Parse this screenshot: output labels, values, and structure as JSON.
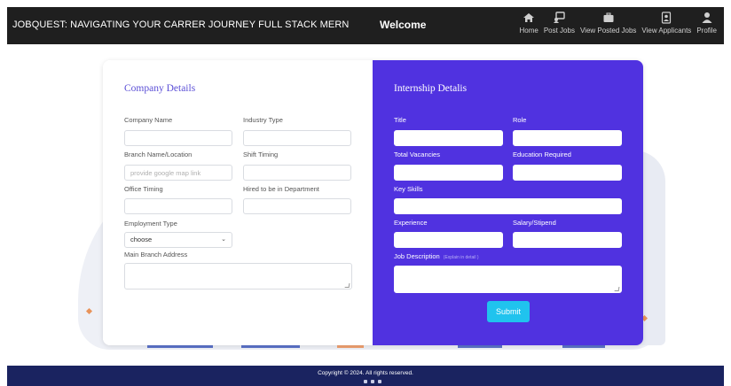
{
  "navbar": {
    "brand": "JOBQUEST: NAVIGATING YOUR CARRER JOURNEY FULL STACK MERN",
    "welcome": "Welcome",
    "items": [
      {
        "label": "Home",
        "icon": "home-icon"
      },
      {
        "label": "Post Jobs",
        "icon": "post-jobs-icon"
      },
      {
        "label": "View Posted Jobs",
        "icon": "briefcase-icon"
      },
      {
        "label": "View Applicants",
        "icon": "applicants-icon"
      },
      {
        "label": "Profile",
        "icon": "user-icon"
      }
    ]
  },
  "company": {
    "title": "Company Details",
    "company_name_label": "Company Name",
    "industry_type_label": "Industry Type",
    "branch_label": "Branch Name/Location",
    "branch_placeholder": "provide google map link",
    "shift_timing_label": "Shift Timing",
    "office_timing_label": "Office Timing",
    "department_label": "Hired to be in Department",
    "employment_type_label": "Employment Type",
    "employment_type_value": "choose",
    "main_branch_label": "Main Branch Address"
  },
  "internship": {
    "title": "Internship Detalis",
    "title_label": "Title",
    "role_label": "Role",
    "vacancies_label": "Total Vacancies",
    "education_label": "Education Required",
    "key_skills_label": "Key Skills",
    "experience_label": "Experience",
    "salary_label": "Salary/Stipend",
    "job_description_label": "Job Description",
    "job_description_hint": "(Explain in detail )",
    "submit_label": "Submit"
  },
  "footer": {
    "copyright": "Copyright © 2024. All rights reserved."
  },
  "colors": {
    "navbar": "#1f1f1f",
    "panel_accent": "#5032e0",
    "submit": "#20c3ee",
    "footer": "#1a2360",
    "section_title": "#5b4fd6"
  }
}
